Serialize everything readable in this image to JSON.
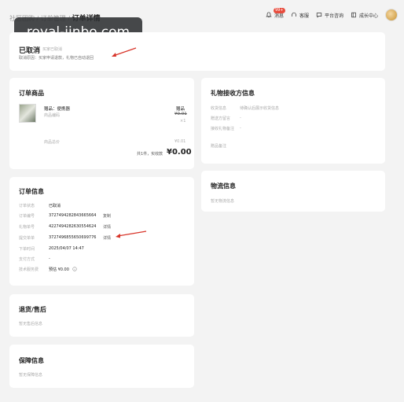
{
  "breadcrumb": {
    "path": "社区团购 / 订单管理 / ",
    "current": "订单详情"
  },
  "watermark": "royal-jinbo.com",
  "topnav": {
    "msg": "消息",
    "msg_badge": "99+",
    "service": "客服",
    "platform": "平台咨询",
    "growth": "成长中心"
  },
  "status": {
    "title": "已取消",
    "subtitle": "买家已取消",
    "reason_label": "取消原因：",
    "reason_value": "买家申请退款，礼物已自动退回"
  },
  "goods": {
    "heading": "订单商品",
    "name_label": "赠品：",
    "name_value": "便携器",
    "code_label": "商品编码",
    "gift_tag": "赠品",
    "price": "¥0.01",
    "qty": "×1",
    "total_label": "商品总价",
    "total_value": "¥0.01",
    "summary_label": "共1件，实收款",
    "summary_value": "¥0.00"
  },
  "receiver": {
    "heading": "礼物接收方信息",
    "rows": [
      {
        "label": "收货信息",
        "value": "待确认后展示收货信息"
      },
      {
        "label": "赠送方留言",
        "value": "-"
      },
      {
        "label": "接收礼物备注",
        "value": "-"
      },
      {
        "label": "赠品备注",
        "value": ""
      }
    ]
  },
  "logistics": {
    "heading": "物流信息",
    "empty": "暂无物流信息"
  },
  "order": {
    "heading": "订单信息",
    "rows": [
      {
        "label": "订单状态",
        "value": "已取消",
        "action": ""
      },
      {
        "label": "订单编号",
        "value": "3727494282843665664",
        "action": "复制"
      },
      {
        "label": "礼物单号",
        "value": "4227494282630554624",
        "action": "详情"
      },
      {
        "label": "提交单单",
        "value": "3727496855650699776",
        "action": "详情"
      },
      {
        "label": "下单时间",
        "value": "2025/04/07 14:47",
        "action": ""
      },
      {
        "label": "支付方式",
        "value": "-",
        "action": ""
      },
      {
        "label": "技术服务费",
        "value": "预估 ¥0.00",
        "action": ""
      }
    ]
  },
  "refund": {
    "heading": "退货/售后",
    "empty": "暂无售后信息"
  },
  "guarantee": {
    "heading": "保障信息",
    "empty": "暂无保障信息"
  },
  "colors": {
    "accent": "#e84c3d",
    "annotation": "#d8352a"
  }
}
